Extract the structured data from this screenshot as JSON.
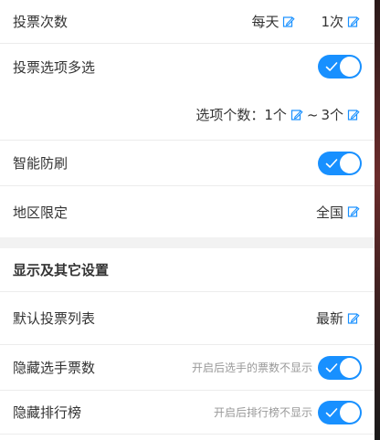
{
  "colors": {
    "accent": "#1890ff",
    "section_gap": "#f2f2f2"
  },
  "rows": {
    "vote_count": {
      "label": "投票次数",
      "period": "每天",
      "count": "1次"
    },
    "multi_select": {
      "label": "投票选项多选",
      "on": true
    },
    "option_count": {
      "prefix": "选项个数：",
      "min": "1个",
      "sep": "~",
      "max": "3个"
    },
    "anti_cheat": {
      "label": "智能防刷",
      "on": true
    },
    "region": {
      "label": "地区限定",
      "value": "全国"
    },
    "section": {
      "title": "显示及其它设置"
    },
    "default_list": {
      "label": "默认投票列表",
      "value": "最新"
    },
    "hide_votes": {
      "label": "隐藏选手票数",
      "hint": "开启后选手的票数不显示",
      "on": true
    },
    "hide_rank": {
      "label": "隐藏排行榜",
      "hint": "开启后排行榜不显示",
      "on": true
    }
  }
}
